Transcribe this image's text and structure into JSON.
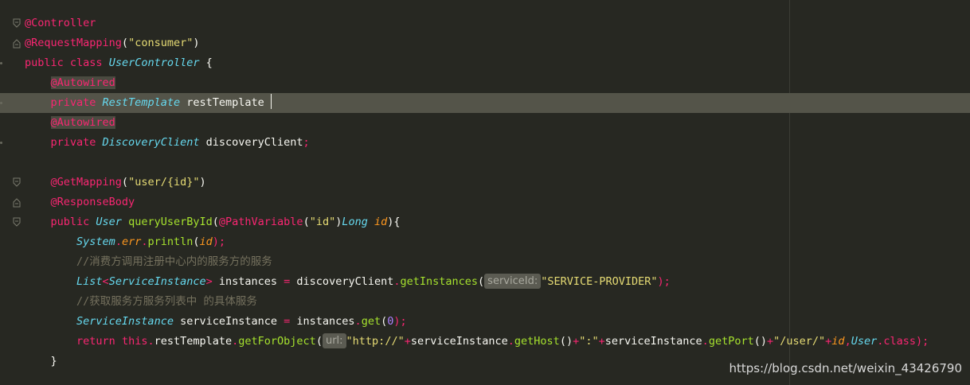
{
  "editor": {
    "lines": [
      {
        "tokens": [
          {
            "t": "@Controller",
            "c": "ann"
          }
        ],
        "fold": "open"
      },
      {
        "tokens": [
          {
            "t": "@RequestMapping",
            "c": "ann"
          },
          {
            "t": "(",
            "c": "punc"
          },
          {
            "t": "\"consumer\"",
            "c": "str"
          },
          {
            "t": ")",
            "c": "punc"
          }
        ],
        "fold": "close"
      },
      {
        "tokens": [
          {
            "t": "public ",
            "c": "kw"
          },
          {
            "t": "class ",
            "c": "kw"
          },
          {
            "t": "UserController",
            "c": "type"
          },
          {
            "t": " {",
            "c": "punc"
          }
        ],
        "mark": true
      },
      {
        "tokens": [
          {
            "t": "    ",
            "c": "punc"
          },
          {
            "t": "@Autowired",
            "c": "ann hl-ann"
          }
        ]
      },
      {
        "tokens": [
          {
            "t": "    ",
            "c": "punc"
          },
          {
            "t": "private ",
            "c": "kw"
          },
          {
            "t": "RestTemplate",
            "c": "type"
          },
          {
            "t": " restTemplate ",
            "c": "punc"
          },
          {
            "caret": true
          }
        ],
        "current": true,
        "mark": true
      },
      {
        "tokens": [
          {
            "t": "    ",
            "c": "punc"
          },
          {
            "t": "@Autowired",
            "c": "ann hl-ann"
          }
        ]
      },
      {
        "tokens": [
          {
            "t": "    ",
            "c": "punc"
          },
          {
            "t": "private ",
            "c": "kw"
          },
          {
            "t": "DiscoveryClient",
            "c": "type"
          },
          {
            "t": " discoveryClient",
            "c": "punc"
          },
          {
            "t": ";",
            "c": "op"
          }
        ],
        "mark": true
      },
      {
        "tokens": []
      },
      {
        "tokens": [
          {
            "t": "    ",
            "c": "punc"
          },
          {
            "t": "@GetMapping",
            "c": "ann"
          },
          {
            "t": "(",
            "c": "punc"
          },
          {
            "t": "\"user/{id}\"",
            "c": "str"
          },
          {
            "t": ")",
            "c": "punc"
          }
        ],
        "fold": "open"
      },
      {
        "tokens": [
          {
            "t": "    ",
            "c": "punc"
          },
          {
            "t": "@ResponseBody",
            "c": "ann"
          }
        ],
        "fold": "close"
      },
      {
        "tokens": [
          {
            "t": "    ",
            "c": "punc"
          },
          {
            "t": "public ",
            "c": "kw"
          },
          {
            "t": "User",
            "c": "type"
          },
          {
            "t": " ",
            "c": "punc"
          },
          {
            "t": "queryUserById",
            "c": "fn"
          },
          {
            "t": "(",
            "c": "punc"
          },
          {
            "t": "@PathVariable",
            "c": "ann"
          },
          {
            "t": "(",
            "c": "punc"
          },
          {
            "t": "\"id\"",
            "c": "str"
          },
          {
            "t": ")",
            "c": "punc"
          },
          {
            "t": "Long",
            "c": "type"
          },
          {
            "t": " ",
            "c": "punc"
          },
          {
            "t": "id",
            "c": "param"
          },
          {
            "t": "){",
            "c": "punc"
          }
        ],
        "fold": "open"
      },
      {
        "tokens": [
          {
            "t": "        ",
            "c": "punc"
          },
          {
            "t": "System",
            "c": "type"
          },
          {
            "t": ".",
            "c": "op"
          },
          {
            "t": "err",
            "c": "param"
          },
          {
            "t": ".",
            "c": "op"
          },
          {
            "t": "println",
            "c": "fn"
          },
          {
            "t": "(",
            "c": "punc"
          },
          {
            "t": "id",
            "c": "param"
          },
          {
            "t": ");",
            "c": "op"
          }
        ]
      },
      {
        "tokens": [
          {
            "t": "        ",
            "c": "punc"
          },
          {
            "t": "//消费方调用注册中心内的服务方的服务",
            "c": "cmt"
          }
        ]
      },
      {
        "tokens": [
          {
            "t": "        ",
            "c": "punc"
          },
          {
            "t": "List",
            "c": "type"
          },
          {
            "t": "<",
            "c": "op"
          },
          {
            "t": "ServiceInstance",
            "c": "type"
          },
          {
            "t": ">",
            "c": "op"
          },
          {
            "t": " instances ",
            "c": "punc"
          },
          {
            "t": "=",
            "c": "op"
          },
          {
            "t": " discoveryClient",
            "c": "punc"
          },
          {
            "t": ".",
            "c": "op"
          },
          {
            "t": "getInstances",
            "c": "fn"
          },
          {
            "t": "(",
            "c": "punc"
          },
          {
            "hint": "serviceId:"
          },
          {
            "t": "\"SERVICE-PROVIDER\"",
            "c": "str"
          },
          {
            "t": ");",
            "c": "op"
          }
        ]
      },
      {
        "tokens": [
          {
            "t": "        ",
            "c": "punc"
          },
          {
            "t": "//获取服务方服务列表中 的具体服务",
            "c": "cmt"
          }
        ]
      },
      {
        "tokens": [
          {
            "t": "        ",
            "c": "punc"
          },
          {
            "t": "ServiceInstance",
            "c": "type"
          },
          {
            "t": " serviceInstance ",
            "c": "punc"
          },
          {
            "t": "=",
            "c": "op"
          },
          {
            "t": " instances",
            "c": "punc"
          },
          {
            "t": ".",
            "c": "op"
          },
          {
            "t": "get",
            "c": "fn"
          },
          {
            "t": "(",
            "c": "punc"
          },
          {
            "t": "0",
            "c": "num"
          },
          {
            "t": ");",
            "c": "op"
          }
        ]
      },
      {
        "tokens": [
          {
            "t": "        ",
            "c": "punc"
          },
          {
            "t": "return ",
            "c": "kw"
          },
          {
            "t": "this",
            "c": "kw"
          },
          {
            "t": ".",
            "c": "op"
          },
          {
            "t": "restTemplate",
            "c": "punc"
          },
          {
            "t": ".",
            "c": "op"
          },
          {
            "t": "getForObject",
            "c": "fn"
          },
          {
            "t": "(",
            "c": "punc"
          },
          {
            "hint": "url:"
          },
          {
            "t": "\"http://\"",
            "c": "str"
          },
          {
            "t": "+",
            "c": "op"
          },
          {
            "t": "serviceInstance",
            "c": "punc"
          },
          {
            "t": ".",
            "c": "op"
          },
          {
            "t": "getHost",
            "c": "fn"
          },
          {
            "t": "()",
            "c": "punc"
          },
          {
            "t": "+",
            "c": "op"
          },
          {
            "t": "\":\"",
            "c": "str"
          },
          {
            "t": "+",
            "c": "op"
          },
          {
            "t": "serviceInstance",
            "c": "punc"
          },
          {
            "t": ".",
            "c": "op"
          },
          {
            "t": "getPort",
            "c": "fn"
          },
          {
            "t": "()",
            "c": "punc"
          },
          {
            "t": "+",
            "c": "op"
          },
          {
            "t": "\"/user/\"",
            "c": "str"
          },
          {
            "t": "+",
            "c": "op"
          },
          {
            "t": "id",
            "c": "param"
          },
          {
            "t": ",",
            "c": "op"
          },
          {
            "t": "User",
            "c": "type"
          },
          {
            "t": ".",
            "c": "op"
          },
          {
            "t": "class",
            "c": "kw"
          },
          {
            "t": ");",
            "c": "op"
          }
        ]
      },
      {
        "tokens": [
          {
            "t": "    }",
            "c": "punc"
          }
        ]
      }
    ]
  },
  "watermark": "https://blog.csdn.net/weixin_43426790"
}
